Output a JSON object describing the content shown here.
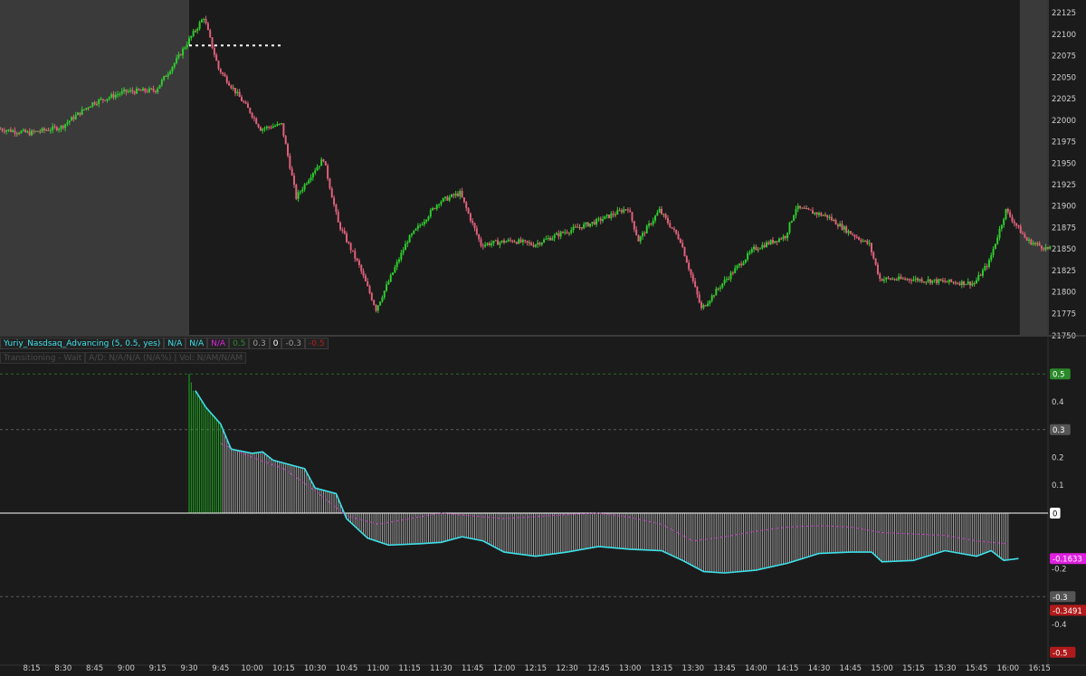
{
  "colors": {
    "background": "#1b1b1b",
    "extended_hours_shading": "#3a3a3a",
    "up_candle": "#2ecc2e",
    "down_candle": "#e0607a",
    "doji_candle": "#9a9a50",
    "advancing_line": "#3ee0e8",
    "dotted_line": "#c040c0",
    "histogram_bar": "#cfcfcf",
    "histogram_positive": "#1fa81f",
    "zero_line": "#ffffff",
    "badge_green": "#2a8a2a",
    "badge_magenta": "#e020e0",
    "badge_red": "#b01a1a",
    "badge_gray": "#555555",
    "header_cyan": "#3ee0e8",
    "header_magenta": "#e020e0"
  },
  "indicator_header": {
    "name": "Yuriy_Nasdsaq_Advancing (5, 0.5, yes)",
    "fields": [
      {
        "text": "N/A",
        "color": "#3ee0e8"
      },
      {
        "text": "N/A",
        "color": "#3ee0e8"
      },
      {
        "text": "N/A",
        "color": "#e020e0"
      },
      {
        "text": "0.5",
        "color": "#2e8b2e"
      },
      {
        "text": "0.3",
        "color": "#9a9a9a"
      },
      {
        "text": "0",
        "color": "#ffffff"
      },
      {
        "text": "-0.3",
        "color": "#9a9a9a"
      },
      {
        "text": "-0.5",
        "color": "#b02020"
      }
    ],
    "status_left": "Transitioning - Wait",
    "status_right": "A/D: N/A/N/A (N/A%) | Vol: N/AM/N/AM"
  },
  "chart_data": [
    {
      "type": "candlestick",
      "price_axis": {
        "range": [
          21750,
          22140
        ],
        "ticks": [
          21775,
          21800,
          21825,
          21850,
          21875,
          21900,
          21925,
          21950,
          21975,
          22000,
          22025,
          22050,
          22075,
          22100,
          22125
        ],
        "partial_label": "21750"
      },
      "regular_session": [
        "9:30",
        "16:00"
      ],
      "reference_level": {
        "price": 22087,
        "from": "9:30",
        "to": "10:15",
        "style": "dotted"
      },
      "series": [
        {
          "time": "8:00",
          "price": 21990
        },
        {
          "time": "8:15",
          "price": 21985
        },
        {
          "time": "8:30",
          "price": 21992
        },
        {
          "time": "8:45",
          "price": 22020
        },
        {
          "time": "9:00",
          "price": 22033
        },
        {
          "time": "9:15",
          "price": 22035
        },
        {
          "time": "9:25",
          "price": 22070
        },
        {
          "time": "9:30",
          "price": 22090
        },
        {
          "time": "9:38",
          "price": 22120
        },
        {
          "time": "9:45",
          "price": 22060
        },
        {
          "time": "10:00",
          "price": 22010
        },
        {
          "time": "10:05",
          "price": 21990
        },
        {
          "time": "10:15",
          "price": 21995
        },
        {
          "time": "10:22",
          "price": 21910
        },
        {
          "time": "10:30",
          "price": 21940
        },
        {
          "time": "10:35",
          "price": 21955
        },
        {
          "time": "10:42",
          "price": 21880
        },
        {
          "time": "10:52",
          "price": 21830
        },
        {
          "time": "11:00",
          "price": 21780
        },
        {
          "time": "11:15",
          "price": 21860
        },
        {
          "time": "11:30",
          "price": 21905
        },
        {
          "time": "11:40",
          "price": 21915
        },
        {
          "time": "11:50",
          "price": 21855
        },
        {
          "time": "12:05",
          "price": 21860
        },
        {
          "time": "12:15",
          "price": 21855
        },
        {
          "time": "12:30",
          "price": 21870
        },
        {
          "time": "12:45",
          "price": 21882
        },
        {
          "time": "13:00",
          "price": 21898
        },
        {
          "time": "13:05",
          "price": 21860
        },
        {
          "time": "13:15",
          "price": 21895
        },
        {
          "time": "13:25",
          "price": 21860
        },
        {
          "time": "13:35",
          "price": 21780
        },
        {
          "time": "13:45",
          "price": 21810
        },
        {
          "time": "14:00",
          "price": 21850
        },
        {
          "time": "14:15",
          "price": 21865
        },
        {
          "time": "14:20",
          "price": 21898
        },
        {
          "time": "14:35",
          "price": 21888
        },
        {
          "time": "14:45",
          "price": 21870
        },
        {
          "time": "14:55",
          "price": 21855
        },
        {
          "time": "15:00",
          "price": 21815
        },
        {
          "time": "15:15",
          "price": 21815
        },
        {
          "time": "15:30",
          "price": 21812
        },
        {
          "time": "15:45",
          "price": 21810
        },
        {
          "time": "15:52",
          "price": 21835
        },
        {
          "time": "16:00",
          "price": 21895
        },
        {
          "time": "16:10",
          "price": 21860
        },
        {
          "time": "16:20",
          "price": 21850
        }
      ]
    },
    {
      "type": "line",
      "value_axis": {
        "range": [
          -0.53,
          0.53
        ],
        "ticks": [
          0.4,
          0.2,
          0.1,
          -0.2,
          -0.4
        ],
        "dashed_levels": [
          0.5,
          0.3,
          -0.3
        ],
        "zero_level": 0
      },
      "badges": [
        {
          "text": "0.5",
          "value": 0.5,
          "color": "#2a8a2a"
        },
        {
          "text": "0.3",
          "value": 0.3,
          "color": "#555555"
        },
        {
          "text": "0",
          "value": 0,
          "color": "#ffffff"
        },
        {
          "text": "-0.1633",
          "value": -0.1633,
          "color": "#e020e0"
        },
        {
          "text": "-0.3",
          "value": -0.3,
          "color": "#555555"
        },
        {
          "text": "-0.3491",
          "value": -0.3491,
          "color": "#b01a1a"
        },
        {
          "text": "-0.5",
          "value": -0.5,
          "color": "#b01a1a"
        }
      ],
      "series": [
        {
          "style": "solid",
          "points": [
            {
              "time": "9:33",
              "value": 0.44
            },
            {
              "time": "9:38",
              "value": 0.38
            },
            {
              "time": "9:45",
              "value": 0.32
            },
            {
              "time": "9:50",
              "value": 0.23
            },
            {
              "time": "10:00",
              "value": 0.215
            },
            {
              "time": "10:05",
              "value": 0.22
            },
            {
              "time": "10:10",
              "value": 0.19
            },
            {
              "time": "10:20",
              "value": 0.17
            },
            {
              "time": "10:25",
              "value": 0.16
            },
            {
              "time": "10:30",
              "value": 0.09
            },
            {
              "time": "10:40",
              "value": 0.07
            },
            {
              "time": "10:45",
              "value": -0.02
            },
            {
              "time": "10:55",
              "value": -0.09
            },
            {
              "time": "11:05",
              "value": -0.115
            },
            {
              "time": "11:20",
              "value": -0.11
            },
            {
              "time": "11:30",
              "value": -0.105
            },
            {
              "time": "11:40",
              "value": -0.085
            },
            {
              "time": "11:50",
              "value": -0.1
            },
            {
              "time": "12:00",
              "value": -0.14
            },
            {
              "time": "12:15",
              "value": -0.155
            },
            {
              "time": "12:30",
              "value": -0.14
            },
            {
              "time": "12:45",
              "value": -0.12
            },
            {
              "time": "13:00",
              "value": -0.13
            },
            {
              "time": "13:15",
              "value": -0.135
            },
            {
              "time": "13:25",
              "value": -0.17
            },
            {
              "time": "13:35",
              "value": -0.21
            },
            {
              "time": "13:45",
              "value": -0.215
            },
            {
              "time": "14:00",
              "value": -0.205
            },
            {
              "time": "14:15",
              "value": -0.18
            },
            {
              "time": "14:30",
              "value": -0.145
            },
            {
              "time": "14:45",
              "value": -0.14
            },
            {
              "time": "14:55",
              "value": -0.14
            },
            {
              "time": "15:00",
              "value": -0.175
            },
            {
              "time": "15:15",
              "value": -0.17
            },
            {
              "time": "15:30",
              "value": -0.135
            },
            {
              "time": "15:45",
              "value": -0.155
            },
            {
              "time": "15:52",
              "value": -0.135
            },
            {
              "time": "15:58",
              "value": -0.17
            },
            {
              "time": "16:05",
              "value": -0.1633
            }
          ]
        },
        {
          "style": "dotted",
          "points": [
            {
              "time": "9:45",
              "value": 0.25
            },
            {
              "time": "10:00",
              "value": 0.2
            },
            {
              "time": "10:15",
              "value": 0.16
            },
            {
              "time": "10:30",
              "value": 0.08
            },
            {
              "time": "10:45",
              "value": -0.01
            },
            {
              "time": "11:00",
              "value": -0.04
            },
            {
              "time": "11:15",
              "value": -0.02
            },
            {
              "time": "11:30",
              "value": 0.0
            },
            {
              "time": "11:45",
              "value": -0.01
            },
            {
              "time": "12:00",
              "value": -0.02
            },
            {
              "time": "12:30",
              "value": -0.005
            },
            {
              "time": "12:45",
              "value": 0.0
            },
            {
              "time": "13:00",
              "value": -0.015
            },
            {
              "time": "13:15",
              "value": -0.04
            },
            {
              "time": "13:30",
              "value": -0.1
            },
            {
              "time": "13:45",
              "value": -0.085
            },
            {
              "time": "14:00",
              "value": -0.065
            },
            {
              "time": "14:15",
              "value": -0.05
            },
            {
              "time": "14:30",
              "value": -0.045
            },
            {
              "time": "14:45",
              "value": -0.05
            },
            {
              "time": "15:00",
              "value": -0.07
            },
            {
              "time": "15:15",
              "value": -0.075
            },
            {
              "time": "15:30",
              "value": -0.08
            },
            {
              "time": "15:45",
              "value": -0.1
            },
            {
              "time": "16:00",
              "value": -0.11
            }
          ]
        },
        {
          "style": "histogram",
          "from": "9:30",
          "to": "16:00",
          "positive_until": "9:45"
        }
      ]
    }
  ],
  "time_axis": {
    "labels": [
      "8:15",
      "8:30",
      "8:45",
      "9:00",
      "9:15",
      "9:30",
      "9:45",
      "10:00",
      "10:15",
      "10:30",
      "10:45",
      "11:00",
      "11:15",
      "11:30",
      "11:45",
      "12:00",
      "12:15",
      "12:30",
      "12:45",
      "13:00",
      "13:15",
      "13:30",
      "13:45",
      "14:00",
      "14:15",
      "14:30",
      "14:45",
      "15:00",
      "15:15",
      "15:30",
      "15:45",
      "16:00",
      "16:15"
    ]
  }
}
